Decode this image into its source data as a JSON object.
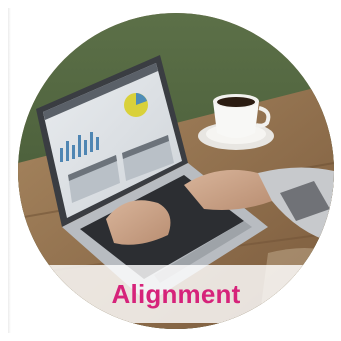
{
  "caption": {
    "label": "Alignment",
    "color": "#d6237a"
  },
  "photo": {
    "subject": "laptop-with-analytics-dashboard-and-coffee-cup"
  },
  "colors": {
    "background": "#ffffff",
    "band": "#ffffff"
  }
}
